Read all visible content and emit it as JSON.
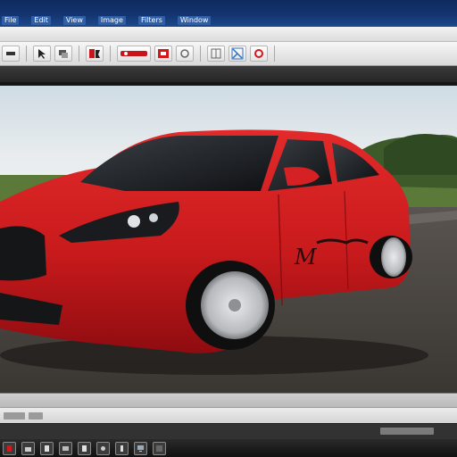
{
  "menu": {
    "items": [
      {
        "label": "File"
      },
      {
        "label": "Edit"
      },
      {
        "label": "View"
      },
      {
        "label": "Image"
      },
      {
        "label": "Filters"
      },
      {
        "label": "Window"
      }
    ]
  },
  "icons": {
    "toolbar": [
      "tool-icon",
      "cursor-icon",
      "layers-icon",
      "image-icon",
      "record-icon",
      "rectangle-icon",
      "stop-icon",
      "grid-icon",
      "crop-icon",
      "warning-icon",
      "chevron-icon"
    ],
    "taskbar": [
      "start-icon",
      "folder-icon",
      "document-icon",
      "image-icon",
      "file-icon",
      "settings-icon",
      "media-icon",
      "monitor-icon",
      "terminal-icon"
    ]
  },
  "canvas": {
    "car_text": "M"
  },
  "colors": {
    "accent_red": "#d3171a",
    "titlebar_blue": "#14346f"
  }
}
